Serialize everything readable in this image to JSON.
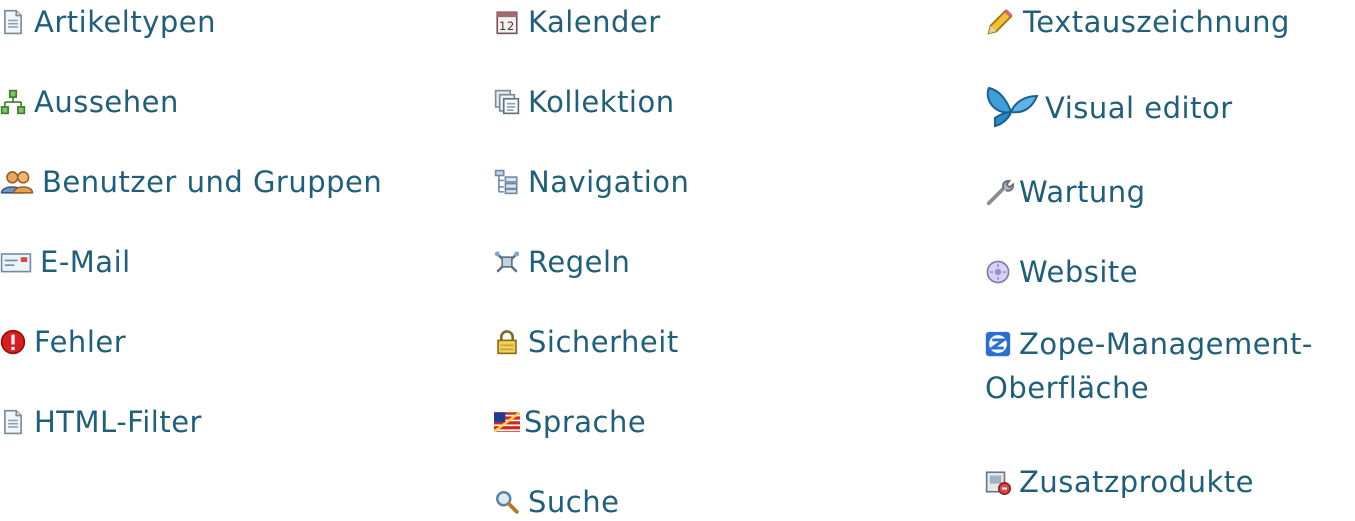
{
  "columns": [
    {
      "items": [
        {
          "label": "Artikeltypen",
          "icon": "document-icon"
        },
        {
          "label": "Aussehen",
          "icon": "sitemap-icon"
        },
        {
          "label": "Benutzer und Gruppen",
          "icon": "users-icon"
        },
        {
          "label": "E-Mail",
          "icon": "mail-icon"
        },
        {
          "label": "Fehler",
          "icon": "error-icon"
        },
        {
          "label": "HTML-Filter",
          "icon": "document-icon"
        }
      ]
    },
    {
      "items": [
        {
          "label": "Kalender",
          "icon": "calendar-icon"
        },
        {
          "label": "Kollektion",
          "icon": "collection-icon"
        },
        {
          "label": "Navigation",
          "icon": "tree-icon"
        },
        {
          "label": "Regeln",
          "icon": "rules-icon"
        },
        {
          "label": "Sicherheit",
          "icon": "lock-icon"
        },
        {
          "label": "Sprache",
          "icon": "flag-icon"
        },
        {
          "label": "Suche",
          "icon": "search-icon"
        }
      ]
    },
    {
      "items": [
        {
          "label": "Textauszeichnung",
          "icon": "pencil-icon"
        },
        {
          "label": "Visual editor",
          "icon": "butterfly-icon"
        },
        {
          "label": "Wartung",
          "icon": "wrench-icon"
        },
        {
          "label": "Website",
          "icon": "globe-icon"
        },
        {
          "label": "Zope-Management-Oberfläche",
          "icon": "zope-icon"
        },
        {
          "label": "Zusatzprodukte",
          "icon": "addon-icon"
        }
      ]
    }
  ],
  "colors": {
    "link": "#1f5f7a"
  }
}
